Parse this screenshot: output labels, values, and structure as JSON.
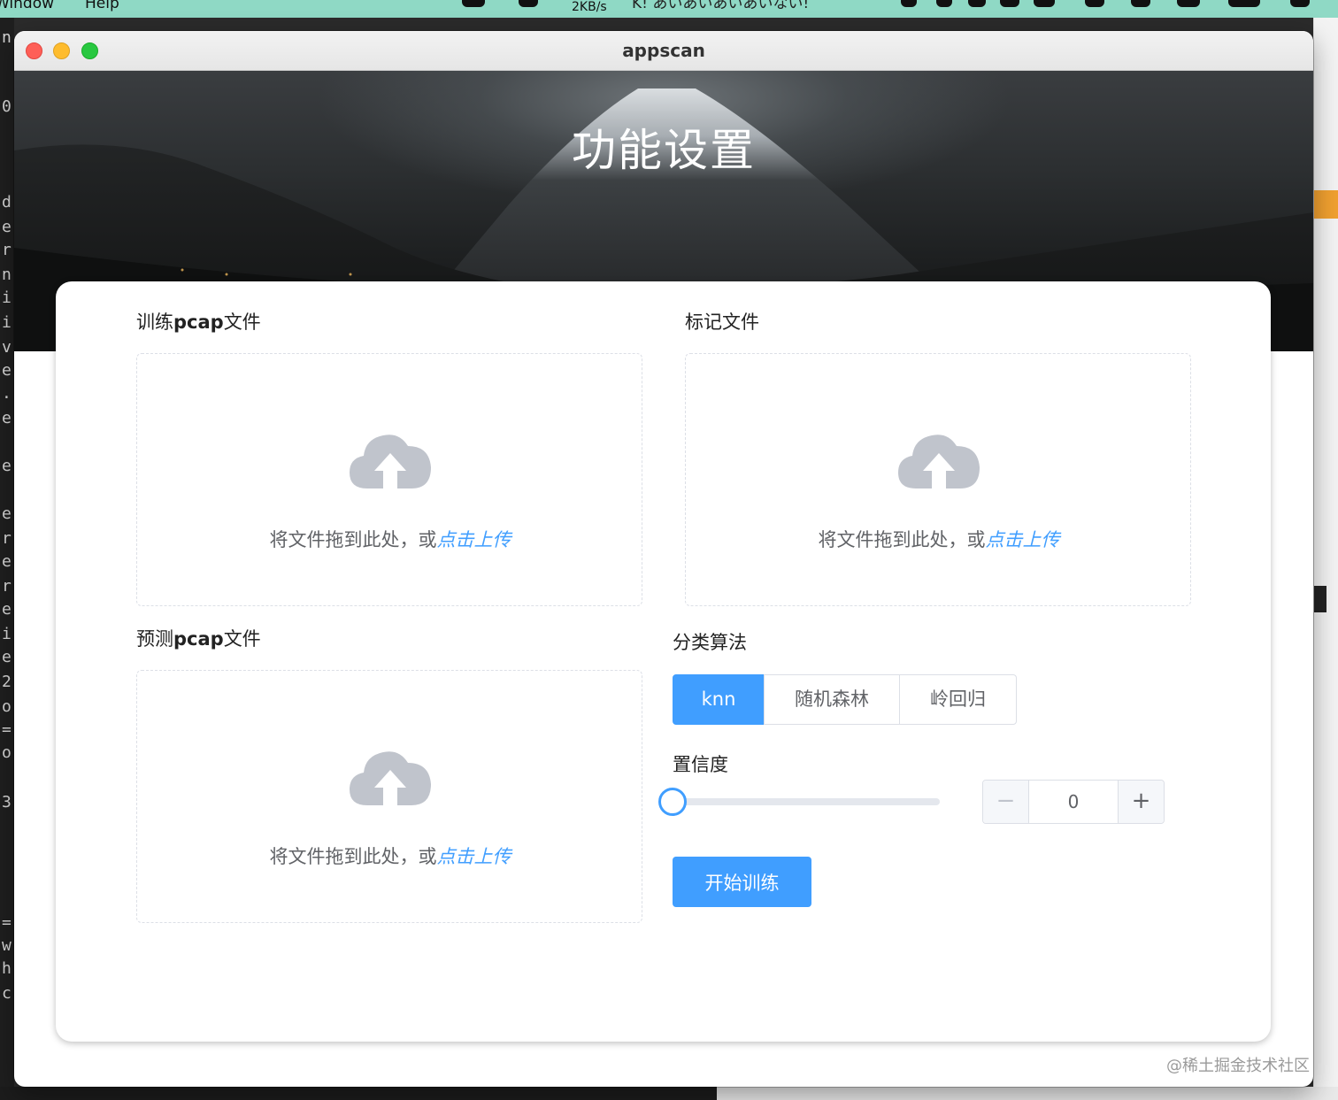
{
  "menubar": {
    "items": [
      "Window",
      "Help"
    ],
    "net_speed": "2KB/s",
    "status_text": "K! あいあいあいあいない!"
  },
  "window": {
    "title": "appscan"
  },
  "hero": {
    "title": "功能设置"
  },
  "uploads": {
    "train": {
      "label_prefix": "训练",
      "label_bold": "pcap",
      "label_suffix": "文件",
      "hint": "将文件拖到此处，或",
      "link": "点击上传",
      "icon": "cloud-upload-icon"
    },
    "mark": {
      "label": "标记文件",
      "hint": "将文件拖到此处，或",
      "link": "点击上传",
      "icon": "cloud-upload-icon"
    },
    "predict": {
      "label_prefix": "预测",
      "label_bold": "pcap",
      "label_suffix": "文件",
      "hint": "将文件拖到此处，或",
      "link": "点击上传",
      "icon": "cloud-upload-icon"
    }
  },
  "algorithm": {
    "label": "分类算法",
    "options": [
      "knn",
      "随机森林",
      "岭回归"
    ],
    "selected": "knn"
  },
  "confidence": {
    "label": "置信度",
    "value": "0",
    "slider_fraction": 0,
    "dec_symbol": "−",
    "inc_symbol": "+"
  },
  "actions": {
    "start_training": "开始训练"
  },
  "watermark": "@稀土掘金技术社区",
  "colors": {
    "primary": "#409eff",
    "border": "#dcdfe6",
    "text": "#606266",
    "icon_gray": "#c0c4cc"
  }
}
